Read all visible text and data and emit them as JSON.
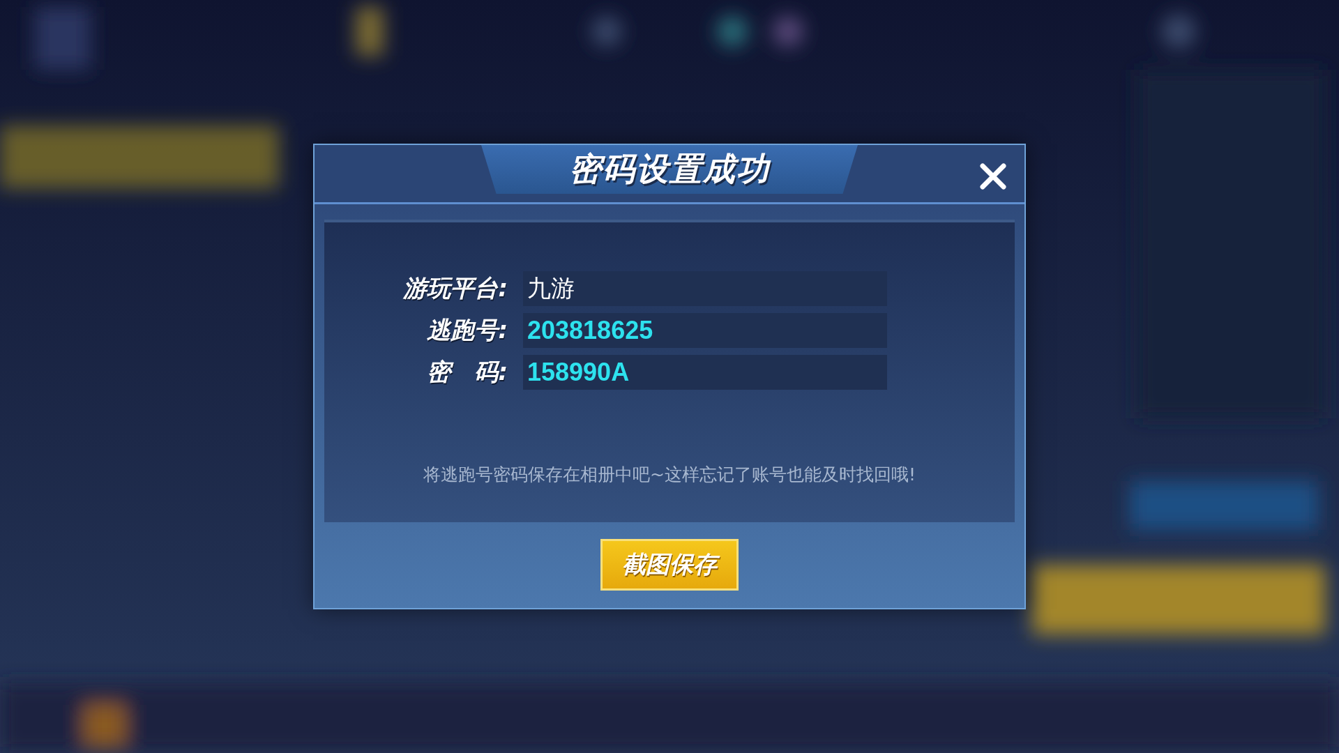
{
  "dialog": {
    "title": "密码设置成功",
    "fields": [
      {
        "label": "游玩平台:",
        "value": "九游",
        "kind": "plain"
      },
      {
        "label": "逃跑号:",
        "value": "203818625",
        "kind": "code"
      },
      {
        "label": "密　码:",
        "value": "158990A",
        "kind": "code"
      }
    ],
    "note": "将逃跑号密码保存在相册中吧~这样忘记了账号也能及时找回哦!",
    "button": "截图保存"
  }
}
